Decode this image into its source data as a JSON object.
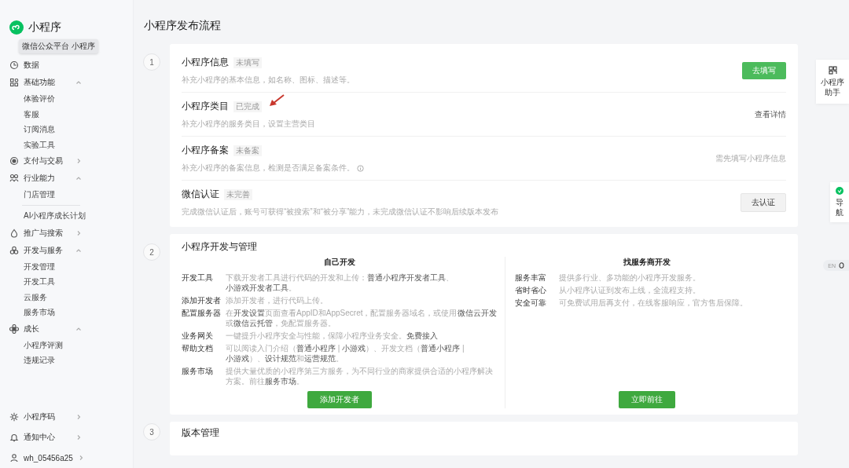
{
  "app": {
    "name": "小程序",
    "tooltip": "微信公众平台 小程序"
  },
  "sidebar": {
    "items": [
      {
        "kind": "link",
        "label": "数据"
      },
      {
        "kind": "group",
        "label": "基础功能",
        "expanded": true,
        "children": [
          {
            "label": "体验评价"
          },
          {
            "label": "客服"
          },
          {
            "label": "订阅消息"
          },
          {
            "label": "实验工具"
          }
        ]
      },
      {
        "kind": "group",
        "label": "支付与交易",
        "expanded": false
      },
      {
        "kind": "group",
        "label": "行业能力",
        "expanded": true,
        "children": [
          {
            "label": "门店管理"
          }
        ]
      },
      {
        "kind": "plain",
        "label": "AI小程序成长计划"
      },
      {
        "kind": "group",
        "label": "推广与搜索",
        "expanded": false
      },
      {
        "kind": "group",
        "label": "开发与服务",
        "expanded": true,
        "children": [
          {
            "label": "开发管理"
          },
          {
            "label": "开发工具"
          },
          {
            "label": "云服务"
          },
          {
            "label": "服务市场"
          }
        ]
      },
      {
        "kind": "group",
        "label": "成长",
        "expanded": true,
        "children": [
          {
            "label": "小程序评测"
          },
          {
            "label": "违规记录"
          }
        ]
      }
    ],
    "footer_items": [
      {
        "label": "小程序码"
      },
      {
        "label": "通知中心"
      },
      {
        "label": "wh_05456a25"
      }
    ]
  },
  "page_title": "小程序发布流程",
  "steps": [
    {
      "number": "1",
      "kind": "tasks",
      "tasks": [
        {
          "title": "小程序信息",
          "status": "未填写",
          "description": "补充小程序的基本信息，如名称、图标、描述等。",
          "info": false,
          "annotated": false,
          "action": {
            "kind": "primary",
            "label": "去填写"
          }
        },
        {
          "title": "小程序类目",
          "status": "已完成",
          "description": "补充小程序的服务类目，设置主营类目",
          "info": false,
          "annotated": true,
          "action": {
            "kind": "link",
            "label": "查看详情"
          }
        },
        {
          "title": "小程序备案",
          "status": "未备案",
          "description": "补充小程序的备案信息，检测是否满足备案条件。",
          "info": true,
          "annotated": false,
          "action": {
            "kind": "note",
            "label": "需先填写小程序信息"
          }
        },
        {
          "title": "微信认证",
          "status": "未完善",
          "description": "完成微信认证后，账号可获得“被搜索”和“被分享”能力，未完成微信认证不影响后续版本发布",
          "info": false,
          "annotated": false,
          "action": {
            "kind": "default",
            "label": "去认证"
          }
        }
      ]
    },
    {
      "number": "2",
      "kind": "dev",
      "title": "小程序开发与管理",
      "columns": [
        {
          "heading": "自己开发",
          "button": "添加开发者",
          "rows": [
            {
              "label": "开发工具",
              "parts": [
                {
                  "text": "下载开发者工具进行代码的开发和上传：",
                  "link": false
                },
                {
                  "text": "普通小程序开发者工具",
                  "link": true
                },
                {
                  "text": "、",
                  "link": false
                },
                {
                  "text": "小游戏开发者工具",
                  "link": true
                },
                {
                  "text": "。",
                  "link": false
                }
              ]
            },
            {
              "label": "添加开发者",
              "parts": [
                {
                  "text": "添加开发者，进行代码上传。",
                  "link": false
                }
              ]
            },
            {
              "label": "配置服务器",
              "parts": [
                {
                  "text": "在",
                  "link": false
                },
                {
                  "text": "开发设置",
                  "link": true
                },
                {
                  "text": "页面查看AppID和AppSecret，配置服务器域名，或使用",
                  "link": false
                },
                {
                  "text": "微信云开发",
                  "link": true
                },
                {
                  "text": "或",
                  "link": false
                },
                {
                  "text": "微信云托管",
                  "link": true
                },
                {
                  "text": "，免配置服务器。",
                  "link": false
                }
              ]
            },
            {
              "label": "业务网关",
              "parts": [
                {
                  "text": "一键提升小程序安全与性能，保障小程序业务安全。",
                  "link": false
                },
                {
                  "text": "免费接入",
                  "link": true
                }
              ]
            },
            {
              "label": "帮助文档",
              "parts": [
                {
                  "text": "可以阅读入门介绍（",
                  "link": false
                },
                {
                  "text": "普通小程序",
                  "link": true
                },
                {
                  "text": " | ",
                  "link": false
                },
                {
                  "text": "小游戏",
                  "link": true
                },
                {
                  "text": "）、开发文档（",
                  "link": false
                },
                {
                  "text": "普通小程序",
                  "link": true
                },
                {
                  "text": " | ",
                  "link": false
                },
                {
                  "text": "小游戏",
                  "link": true
                },
                {
                  "text": "）、",
                  "link": false
                },
                {
                  "text": "设计规范",
                  "link": true
                },
                {
                  "text": "和",
                  "link": false
                },
                {
                  "text": "运营规范",
                  "link": true
                },
                {
                  "text": "。",
                  "link": false
                }
              ]
            },
            {
              "label": "服务市场",
              "parts": [
                {
                  "text": "提供大量优质的小程序第三方服务，为不同行业的商家提供合适的小程序解决方案。前往",
                  "link": false
                },
                {
                  "text": "服务市场",
                  "link": true
                },
                {
                  "text": "。",
                  "link": false
                }
              ]
            }
          ]
        },
        {
          "heading": "找服务商开发",
          "button": "立即前往",
          "rows": [
            {
              "label": "服务丰富",
              "parts": [
                {
                  "text": "提供多行业、多功能的小程序开发服务。",
                  "link": false
                }
              ]
            },
            {
              "label": "省时省心",
              "parts": [
                {
                  "text": "从小程序认证到发布上线，全流程支持。",
                  "link": false
                }
              ]
            },
            {
              "label": "安全可靠",
              "parts": [
                {
                  "text": "可免费试用后再支付，在线客服响应，官方售后保障。",
                  "link": false
                }
              ]
            }
          ]
        }
      ]
    },
    {
      "number": "3",
      "kind": "title_only",
      "title": "版本管理"
    }
  ],
  "side_tools": [
    {
      "kind": "qr",
      "label": "小程序助手"
    },
    {
      "kind": "guide",
      "label": "导航"
    }
  ],
  "language": {
    "label": "EN",
    "on": false
  }
}
